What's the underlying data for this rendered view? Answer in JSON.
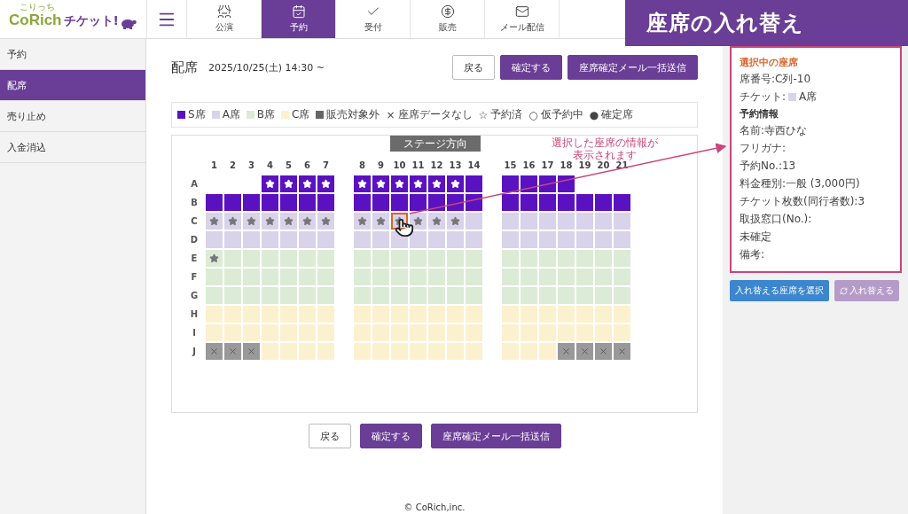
{
  "logo": {
    "kana": "こりっち",
    "brand": "CoRich",
    "product": "チケット!"
  },
  "nav": [
    {
      "label": "公演",
      "selected": false
    },
    {
      "label": "予約",
      "selected": true
    },
    {
      "label": "受付",
      "selected": false
    },
    {
      "label": "販売",
      "selected": false
    },
    {
      "label": "メール配信",
      "selected": false
    }
  ],
  "page_title": "座席の入れ替え",
  "sidebar": [
    {
      "label": "予約",
      "selected": false
    },
    {
      "label": "配席",
      "selected": true
    },
    {
      "label": "売り止め",
      "selected": false
    },
    {
      "label": "入金消込",
      "selected": false
    }
  ],
  "header": {
    "title": "配席",
    "date": "2025/10/25(土) 14:30 ~"
  },
  "top_buttons": [
    {
      "label": "戻る",
      "kind": "plain"
    },
    {
      "label": "確定する",
      "kind": "primary"
    },
    {
      "label": "座席確定メール一括送信",
      "kind": "primary"
    }
  ],
  "legend": [
    {
      "kind": "swatch",
      "color": "#5a12c0",
      "label": "S席"
    },
    {
      "kind": "swatch",
      "color": "#d8d3ea",
      "label": "A席"
    },
    {
      "kind": "swatch",
      "color": "#dcebd5",
      "label": "B席"
    },
    {
      "kind": "swatch",
      "color": "#fcf1cf",
      "label": "C席"
    },
    {
      "kind": "swatch",
      "color": "#666666",
      "label": "販売対象外"
    },
    {
      "kind": "symbol",
      "symbol": "×",
      "label": "座席データなし"
    },
    {
      "kind": "symbol",
      "symbol": "☆",
      "label": "予約済"
    },
    {
      "kind": "symbol",
      "symbol": "○",
      "label": "仮予約中"
    },
    {
      "kind": "symbol",
      "symbol": "●",
      "label": "確定席"
    }
  ],
  "seat_map": {
    "stage": "ステージ方向",
    "columns": [
      "1",
      "2",
      "3",
      "4",
      "5",
      "6",
      "7",
      "8",
      "9",
      "10",
      "11",
      "12",
      "13",
      "14",
      "15",
      "16",
      "17",
      "18",
      "19",
      "20",
      "21"
    ],
    "rows": [
      {
        "label": "A",
        "seats": [
          {
            "kind": "none"
          },
          {
            "kind": "none"
          },
          {
            "kind": "none"
          },
          {
            "kind": "s_res"
          },
          {
            "kind": "s_res"
          },
          {
            "kind": "s_res"
          },
          {
            "kind": "s_res"
          },
          {
            "kind": "s_res"
          },
          {
            "kind": "s_res"
          },
          {
            "kind": "s_res"
          },
          {
            "kind": "s_res"
          },
          {
            "kind": "s_res"
          },
          {
            "kind": "s_res"
          },
          {
            "kind": "s"
          },
          {
            "kind": "s"
          },
          {
            "kind": "s"
          },
          {
            "kind": "s"
          },
          {
            "kind": "s"
          },
          {
            "kind": "none"
          },
          {
            "kind": "none"
          },
          {
            "kind": "none"
          }
        ]
      },
      {
        "label": "B",
        "seats": [
          {
            "kind": "s"
          },
          {
            "kind": "s"
          },
          {
            "kind": "s"
          },
          {
            "kind": "s"
          },
          {
            "kind": "s"
          },
          {
            "kind": "s"
          },
          {
            "kind": "s"
          },
          {
            "kind": "s"
          },
          {
            "kind": "s"
          },
          {
            "kind": "s"
          },
          {
            "kind": "s"
          },
          {
            "kind": "s"
          },
          {
            "kind": "s"
          },
          {
            "kind": "s"
          },
          {
            "kind": "s"
          },
          {
            "kind": "s"
          },
          {
            "kind": "s"
          },
          {
            "kind": "s"
          },
          {
            "kind": "s"
          },
          {
            "kind": "s"
          },
          {
            "kind": "s"
          }
        ]
      },
      {
        "label": "C",
        "seats": [
          {
            "kind": "a_res"
          },
          {
            "kind": "a_res"
          },
          {
            "kind": "a_res"
          },
          {
            "kind": "a_res"
          },
          {
            "kind": "a_res"
          },
          {
            "kind": "a_res"
          },
          {
            "kind": "a_res"
          },
          {
            "kind": "a_res"
          },
          {
            "kind": "a_res"
          },
          {
            "kind": "a_res_sel"
          },
          {
            "kind": "a_res"
          },
          {
            "kind": "a_res"
          },
          {
            "kind": "a_res"
          },
          {
            "kind": "a"
          },
          {
            "kind": "a"
          },
          {
            "kind": "a"
          },
          {
            "kind": "a"
          },
          {
            "kind": "a"
          },
          {
            "kind": "a"
          },
          {
            "kind": "a"
          },
          {
            "kind": "a"
          }
        ]
      },
      {
        "label": "D",
        "seats": [
          {
            "kind": "a"
          },
          {
            "kind": "a"
          },
          {
            "kind": "a"
          },
          {
            "kind": "a"
          },
          {
            "kind": "a"
          },
          {
            "kind": "a"
          },
          {
            "kind": "a"
          },
          {
            "kind": "a"
          },
          {
            "kind": "a"
          },
          {
            "kind": "a"
          },
          {
            "kind": "a"
          },
          {
            "kind": "a"
          },
          {
            "kind": "a"
          },
          {
            "kind": "a"
          },
          {
            "kind": "a"
          },
          {
            "kind": "a"
          },
          {
            "kind": "a"
          },
          {
            "kind": "a"
          },
          {
            "kind": "a"
          },
          {
            "kind": "a"
          },
          {
            "kind": "a"
          }
        ]
      },
      {
        "label": "E",
        "seats": [
          {
            "kind": "b_res"
          },
          {
            "kind": "b"
          },
          {
            "kind": "b"
          },
          {
            "kind": "b"
          },
          {
            "kind": "b"
          },
          {
            "kind": "b"
          },
          {
            "kind": "b"
          },
          {
            "kind": "b"
          },
          {
            "kind": "b"
          },
          {
            "kind": "b"
          },
          {
            "kind": "b"
          },
          {
            "kind": "b"
          },
          {
            "kind": "b"
          },
          {
            "kind": "b"
          },
          {
            "kind": "b"
          },
          {
            "kind": "b"
          },
          {
            "kind": "b"
          },
          {
            "kind": "b"
          },
          {
            "kind": "b"
          },
          {
            "kind": "b"
          },
          {
            "kind": "b"
          }
        ]
      },
      {
        "label": "F",
        "seats": [
          {
            "kind": "b"
          },
          {
            "kind": "b"
          },
          {
            "kind": "b"
          },
          {
            "kind": "b"
          },
          {
            "kind": "b"
          },
          {
            "kind": "b"
          },
          {
            "kind": "b"
          },
          {
            "kind": "b"
          },
          {
            "kind": "b"
          },
          {
            "kind": "b"
          },
          {
            "kind": "b"
          },
          {
            "kind": "b"
          },
          {
            "kind": "b"
          },
          {
            "kind": "b"
          },
          {
            "kind": "b"
          },
          {
            "kind": "b"
          },
          {
            "kind": "b"
          },
          {
            "kind": "b"
          },
          {
            "kind": "b"
          },
          {
            "kind": "b"
          },
          {
            "kind": "b"
          }
        ]
      },
      {
        "label": "G",
        "seats": [
          {
            "kind": "b"
          },
          {
            "kind": "b"
          },
          {
            "kind": "b"
          },
          {
            "kind": "b"
          },
          {
            "kind": "b"
          },
          {
            "kind": "b"
          },
          {
            "kind": "b"
          },
          {
            "kind": "b"
          },
          {
            "kind": "b"
          },
          {
            "kind": "b"
          },
          {
            "kind": "b"
          },
          {
            "kind": "b"
          },
          {
            "kind": "b"
          },
          {
            "kind": "b"
          },
          {
            "kind": "b"
          },
          {
            "kind": "b"
          },
          {
            "kind": "b"
          },
          {
            "kind": "b"
          },
          {
            "kind": "b"
          },
          {
            "kind": "b"
          },
          {
            "kind": "b"
          }
        ]
      },
      {
        "label": "H",
        "seats": [
          {
            "kind": "c"
          },
          {
            "kind": "c"
          },
          {
            "kind": "c"
          },
          {
            "kind": "c"
          },
          {
            "kind": "c"
          },
          {
            "kind": "c"
          },
          {
            "kind": "c"
          },
          {
            "kind": "c"
          },
          {
            "kind": "c"
          },
          {
            "kind": "c"
          },
          {
            "kind": "c"
          },
          {
            "kind": "c"
          },
          {
            "kind": "c"
          },
          {
            "kind": "c"
          },
          {
            "kind": "c"
          },
          {
            "kind": "c"
          },
          {
            "kind": "c"
          },
          {
            "kind": "c"
          },
          {
            "kind": "c"
          },
          {
            "kind": "c"
          },
          {
            "kind": "c"
          }
        ]
      },
      {
        "label": "I",
        "seats": [
          {
            "kind": "c"
          },
          {
            "kind": "c"
          },
          {
            "kind": "c"
          },
          {
            "kind": "c"
          },
          {
            "kind": "c"
          },
          {
            "kind": "c"
          },
          {
            "kind": "c"
          },
          {
            "kind": "c"
          },
          {
            "kind": "c"
          },
          {
            "kind": "c"
          },
          {
            "kind": "c"
          },
          {
            "kind": "c"
          },
          {
            "kind": "c"
          },
          {
            "kind": "c"
          },
          {
            "kind": "c"
          },
          {
            "kind": "c"
          },
          {
            "kind": "c"
          },
          {
            "kind": "c"
          },
          {
            "kind": "c"
          },
          {
            "kind": "c"
          },
          {
            "kind": "c"
          }
        ]
      },
      {
        "label": "J",
        "seats": [
          {
            "kind": "x"
          },
          {
            "kind": "x"
          },
          {
            "kind": "x"
          },
          {
            "kind": "c"
          },
          {
            "kind": "c"
          },
          {
            "kind": "c"
          },
          {
            "kind": "c"
          },
          {
            "kind": "c"
          },
          {
            "kind": "c"
          },
          {
            "kind": "c"
          },
          {
            "kind": "c"
          },
          {
            "kind": "c"
          },
          {
            "kind": "c"
          },
          {
            "kind": "c"
          },
          {
            "kind": "c"
          },
          {
            "kind": "c"
          },
          {
            "kind": "c"
          },
          {
            "kind": "x"
          },
          {
            "kind": "x"
          },
          {
            "kind": "x"
          },
          {
            "kind": "x"
          }
        ]
      }
    ]
  },
  "annotation": [
    "選択した座席の情報が",
    "表示されます"
  ],
  "bottom_buttons": [
    {
      "label": "戻る",
      "kind": "plain"
    },
    {
      "label": "確定する",
      "kind": "primary"
    },
    {
      "label": "座席確定メール一括送信",
      "kind": "primary"
    }
  ],
  "details": {
    "title": "選択中の座席",
    "seat": "席番号:C列-10",
    "ticket_label": "チケット:",
    "ticket_grade": "A席",
    "section": "予約情報",
    "lines": [
      "名前:寺西ひな",
      "フリガナ:",
      "予約No.:13",
      "料金種別:一般 (3,000円)",
      "チケット枚数(同行者数):3",
      "取扱窓口(No.):",
      "未確定",
      "備考:"
    ]
  },
  "actions": [
    {
      "label": "入れ替える座席を選択",
      "kind": "primary"
    },
    {
      "label": "入れ替える",
      "kind": "swap"
    }
  ],
  "footer": "© CoRich,inc."
}
